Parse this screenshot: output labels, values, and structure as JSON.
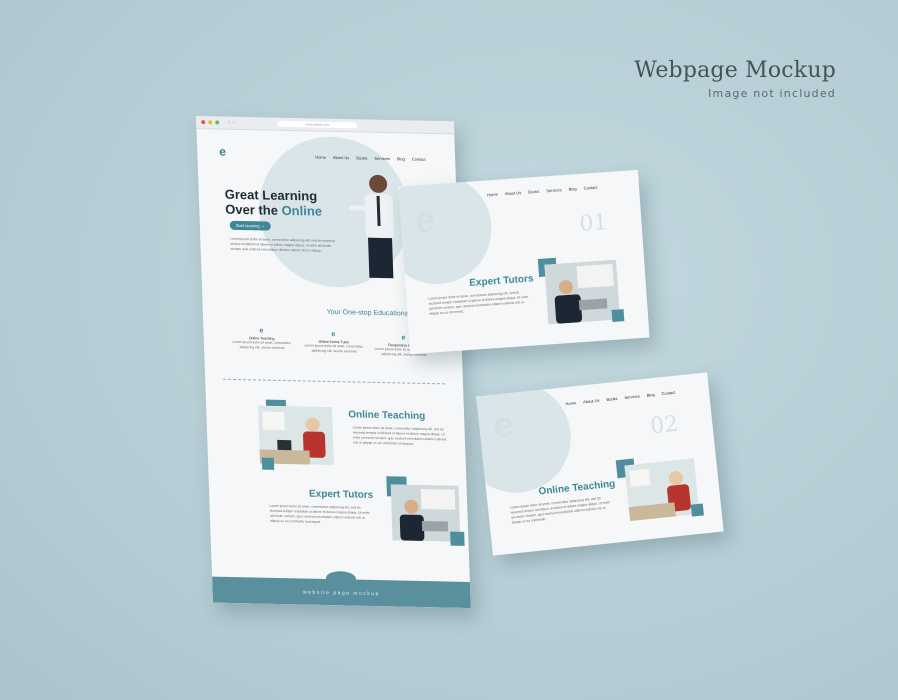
{
  "brand": {
    "title": "Webpage Mockup",
    "subtitle": "Image not included"
  },
  "colors": {
    "accent": "#3f8797",
    "background": "#b9d0d8",
    "footer": "#5a909e"
  },
  "main": {
    "url": "www.website.com",
    "nav": [
      "Home",
      "About Us",
      "Books",
      "Services",
      "Blog",
      "Contact"
    ],
    "hero_line1": "Great Learning",
    "hero_line2_prefix": "Over the ",
    "hero_line2_accent": "Online",
    "cta": "Start learning",
    "hero_text": "Lorem ipsum dolor sit amet, consectetur adipiscing elit, sed do eiusmod tempor incididunt ut labore et dolore magna aliqua. Ut enim ad minim veniam quis nostrud exercitation ullamco laboris nisi ut aliquip.",
    "section_title": "Your One-stop Educational Se",
    "features": [
      {
        "label": "Online Teaching",
        "text": "Lorem ipsum dolor sit amet, consectetur adipiscing elit, sed do eiusmod"
      },
      {
        "label": "Online Home Tutor",
        "text": "Lorem ipsum dolor sit amet, consectetur adipiscing elit, sed do eiusmod"
      },
      {
        "label": "Responsive Classe",
        "text": "Lorem ipsum dolor sit amet, consectetur adipiscing elit, sed do eiusmod"
      }
    ],
    "online_teaching": "Online Teaching",
    "expert_tutors": "Expert Tutors",
    "body_text": "Lorem ipsum dolor sit amet, consectetur adipiscing elit, sed do eiusmod tempor incididunt ut labore et dolore magna aliqua. Ut enim ad minim veniam, quis nostrud exercitation ullamco laboris nisi ut aliquip ex ea commodo consequat.",
    "footer": "website page mockup"
  },
  "card1": {
    "nav": [
      "Home",
      "About Us",
      "Books",
      "Services",
      "Blog",
      "Contact"
    ],
    "num": "01",
    "title": "Expert Tutors",
    "text": "Lorem ipsum dolor sit amet, consectetur adipiscing elit, sed do eiusmod tempor incididunt ut labore et dolore magna aliqua. Ut enim ad minim veniam, quis nostrud exercitation ullamco laboris nisi ut aliquip ex ea commodo."
  },
  "card2": {
    "nav": [
      "Home",
      "About Us",
      "Books",
      "Services",
      "Blog",
      "Contact"
    ],
    "num": "02",
    "title": "Online Teaching",
    "text": "Lorem ipsum dolor sit amet, consectetur adipiscing elit, sed do eiusmod tempor incididunt ut labore et dolore magna aliqua. Ut enim ad minim veniam, quis nostrud exercitation ullamco laboris nisi ut aliquip ex ea commodo."
  }
}
